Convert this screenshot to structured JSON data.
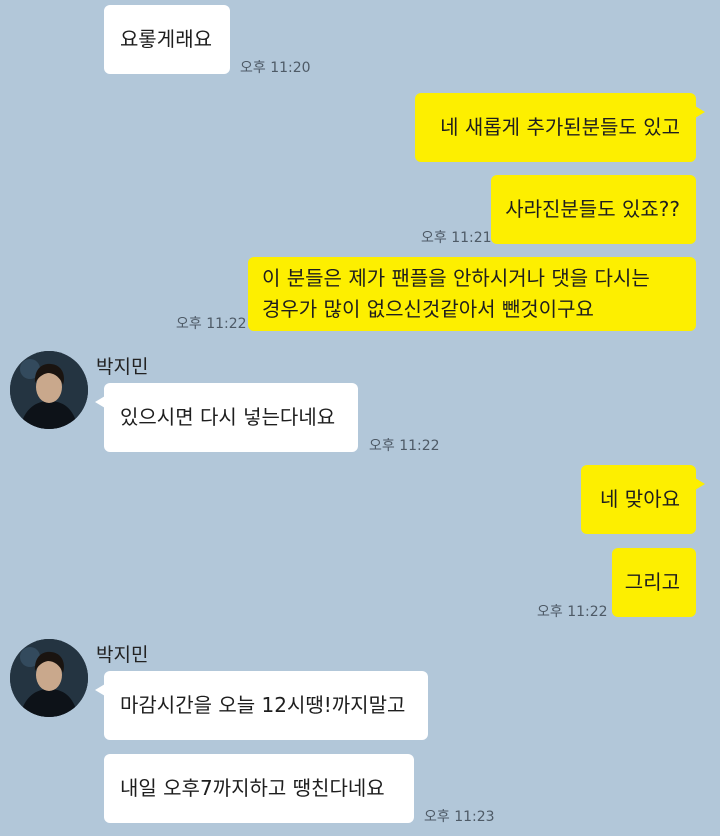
{
  "contact": {
    "name": "박지민"
  },
  "colors": {
    "background": "#b2c7d9",
    "outgoing_bubble": "#fdef00",
    "incoming_bubble": "#ffffff"
  },
  "messages": [
    {
      "sender": "contact",
      "text": "요롷게래요",
      "time": "오후 11:20"
    },
    {
      "sender": "me",
      "text": "네 새롭게 추가된분들도 있고"
    },
    {
      "sender": "me",
      "text": "사라진분들도 있죠??",
      "time": "오후 11:21"
    },
    {
      "sender": "me",
      "lines": [
        "이 분들은 제가 팬플을 안하시거나 댓을 다시는",
        "경우가 많이 없으신것같아서 뺀것이구요"
      ],
      "time": "오후 11:22"
    },
    {
      "sender": "contact",
      "name": "박지민",
      "text": "있으시면 다시 넣는다네요",
      "time": "오후 11:22"
    },
    {
      "sender": "me",
      "text": "네 맞아요"
    },
    {
      "sender": "me",
      "text": "그리고",
      "time": "오후 11:22"
    },
    {
      "sender": "contact",
      "name": "박지민",
      "text": "마감시간을 오늘 12시땡!까지말고"
    },
    {
      "sender": "contact",
      "text": "내일 오후7까지하고 땡친다네요",
      "time": "오후 11:23"
    }
  ]
}
